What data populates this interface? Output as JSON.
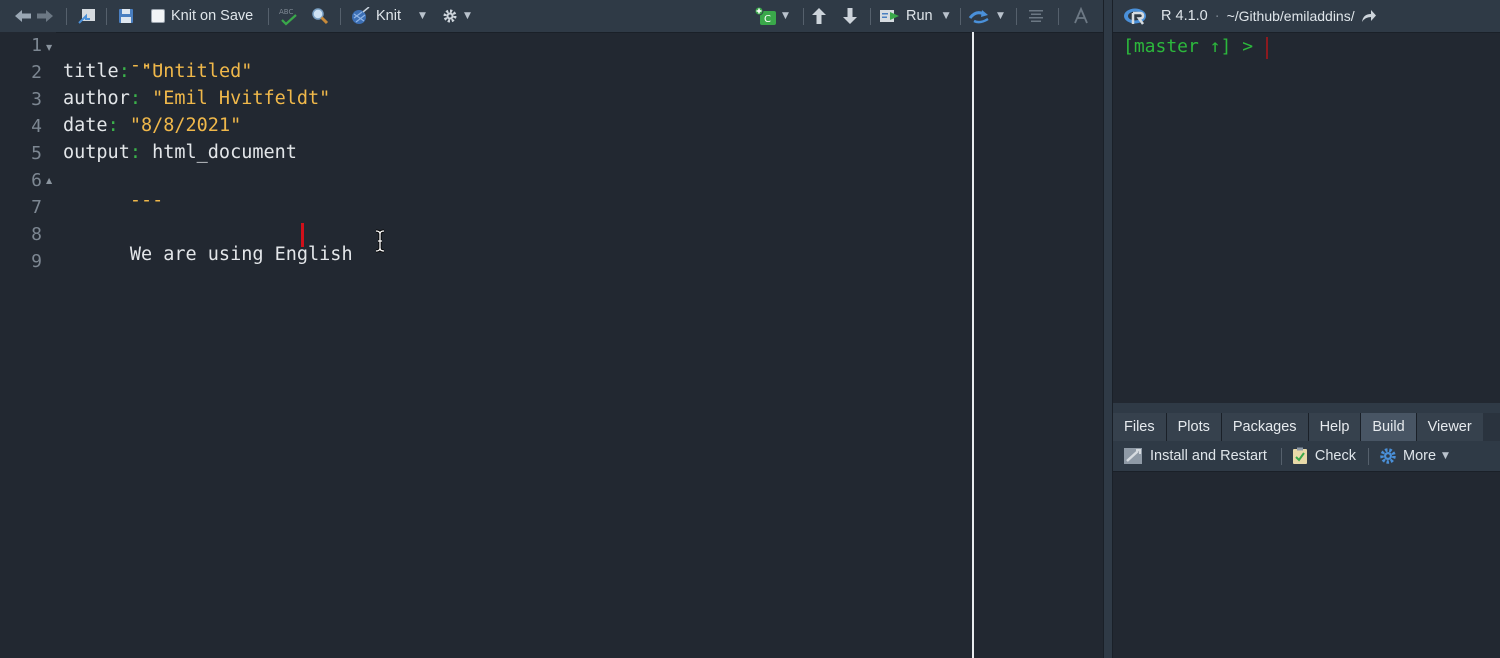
{
  "toolbar": {
    "knit_on_save_label": "Knit on Save",
    "spell_icon_text": "ABC",
    "knit_label": "Knit",
    "run_label": "Run"
  },
  "editor": {
    "line_numbers": [
      "1",
      "2",
      "3",
      "4",
      "5",
      "6",
      "7",
      "8",
      "9"
    ],
    "lines": {
      "l1": "---",
      "l2_key": "title",
      "l2_colon": ":",
      "l2_val": "\"Untitled\"",
      "l3_key": "author",
      "l3_colon": ":",
      "l3_val": "\"Emil Hvitfeldt\"",
      "l4_key": "date",
      "l4_colon": ":",
      "l4_val": "\"8/8/2021\"",
      "l5_key": "output",
      "l5_colon": ":",
      "l5_val": "html_document",
      "l6": "---",
      "l8": "We are using English "
    }
  },
  "console": {
    "r_version": "R 4.1.0",
    "separator": "·",
    "path": "~/Github/emiladdins/",
    "prompt": "[master ↑] >"
  },
  "tabs": [
    "Files",
    "Plots",
    "Packages",
    "Help",
    "Build",
    "Viewer"
  ],
  "active_tab": "Build",
  "build_toolbar": {
    "install_restart": "Install and Restart",
    "check": "Check",
    "more": "More"
  }
}
